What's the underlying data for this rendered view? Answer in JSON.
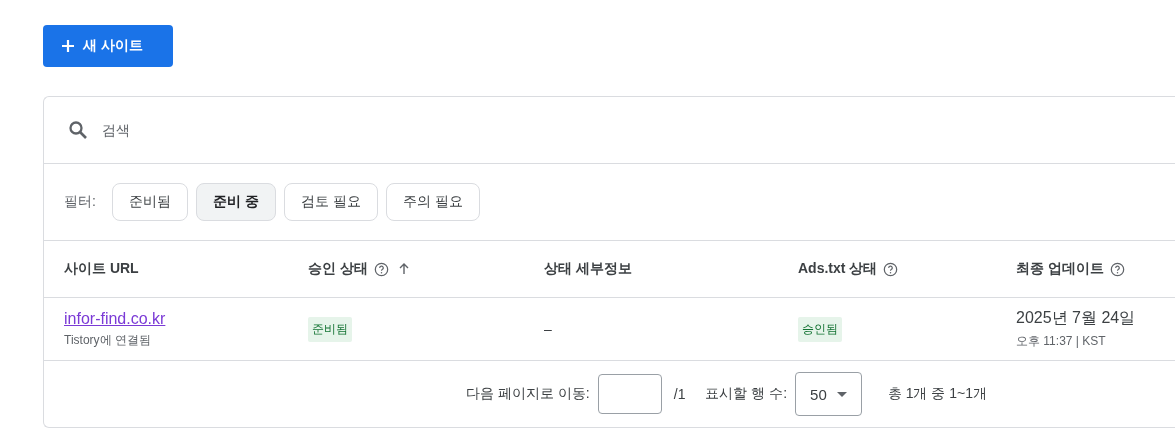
{
  "new_site_button": {
    "label": "새 사이트"
  },
  "search": {
    "placeholder": "검색"
  },
  "filters": {
    "label": "필터:",
    "chips": [
      {
        "label": "준비됨",
        "selected": false
      },
      {
        "label": "준비 중",
        "selected": true
      },
      {
        "label": "검토 필요",
        "selected": false
      },
      {
        "label": "주의 필요",
        "selected": false
      }
    ]
  },
  "table": {
    "columns": [
      {
        "label": "사이트 URL",
        "help": false,
        "sorted": false
      },
      {
        "label": "승인 상태",
        "help": true,
        "sorted": true
      },
      {
        "label": "상태 세부정보",
        "help": false,
        "sorted": false
      },
      {
        "label": "Ads.txt 상태",
        "help": true,
        "sorted": false
      },
      {
        "label": "최종 업데이트",
        "help": true,
        "sorted": false
      }
    ],
    "rows": [
      {
        "url": "infor-find.co.kr",
        "platform": "Tistory에 연결됨",
        "approval": "준비됨",
        "details": "–",
        "ads_txt": "승인됨",
        "date": "2025년 7월 24일",
        "time": "오후 11:37 | KST"
      }
    ]
  },
  "pagination": {
    "goto_label": "다음 페이지로 이동:",
    "page_total": "/1",
    "rows_label": "표시할 행 수:",
    "rows_value": "50",
    "range": "총 1개 중 1~1개"
  }
}
